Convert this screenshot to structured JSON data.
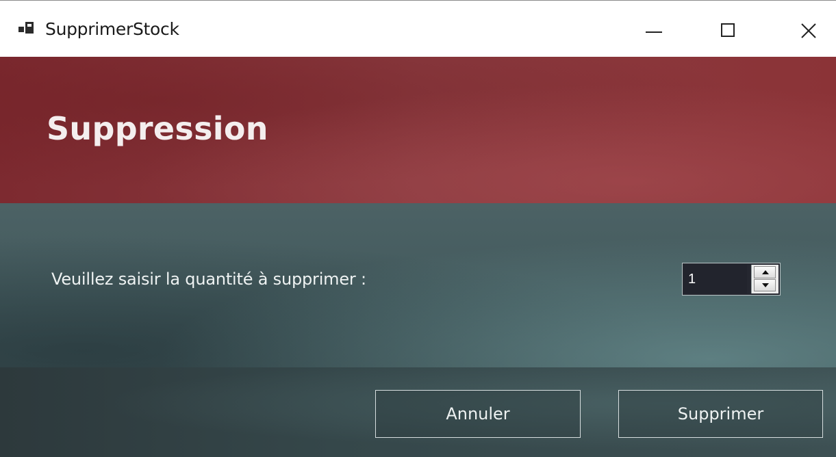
{
  "window": {
    "title": "SupprimerStock",
    "controls": {
      "minimize": "minimize-icon",
      "maximize": "maximize-icon",
      "close": "close-icon"
    }
  },
  "header": {
    "title": "Suppression",
    "color": "#823338"
  },
  "content": {
    "quantity_label": "Veuillez saisir la quantité à supprimer :",
    "quantity_value": "1",
    "color": "#465c5f"
  },
  "footer": {
    "cancel_label": "Annuler",
    "delete_label": "Supprimer",
    "color": "#33454a"
  }
}
